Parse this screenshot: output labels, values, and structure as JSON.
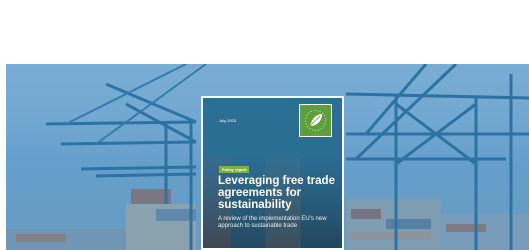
{
  "report": {
    "date": "July 2023",
    "tag": "Policy report",
    "title": "Leveraging free trade agreements for sustainability",
    "subtitle": "A review of the implementation EU's new approach to sustainable trade",
    "logo_icon": "leaf-logo-icon"
  },
  "background": {
    "scene": "container-port-cranes-photo",
    "tint_color": "#2e79b8"
  }
}
